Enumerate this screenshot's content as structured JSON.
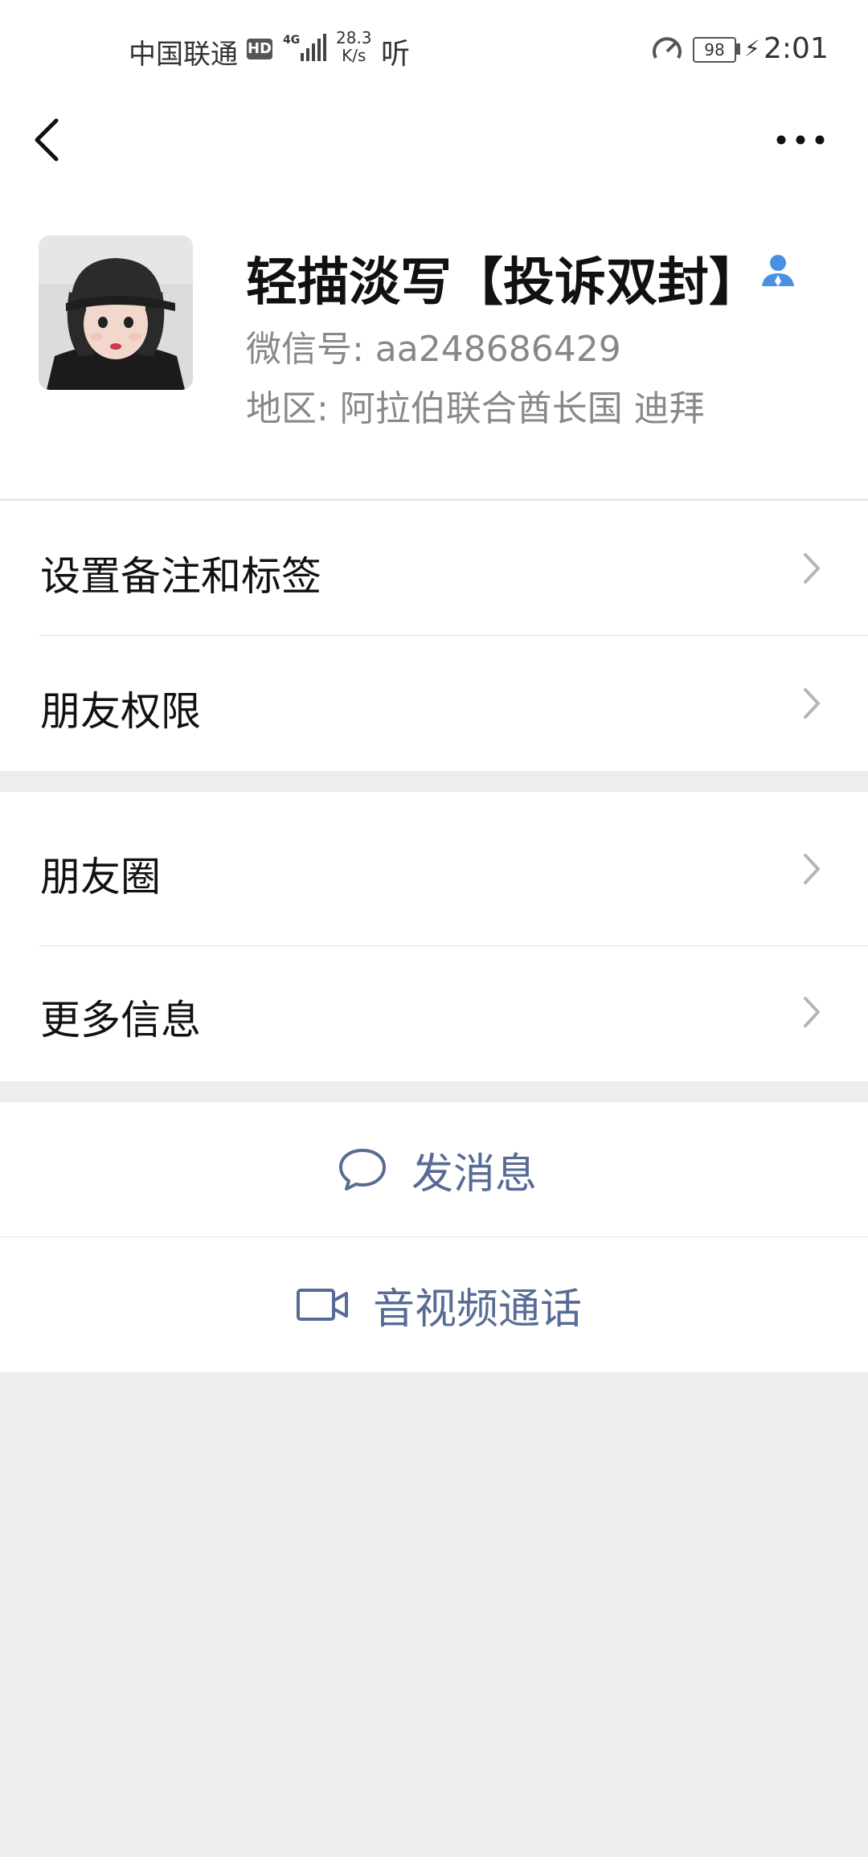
{
  "status_bar": {
    "carrier": "中国联通",
    "hd": "HD",
    "network": "4G",
    "speed_value": "28.3",
    "speed_unit": "K/s",
    "listen_icon_text": "听",
    "battery": "98",
    "time": "2:01"
  },
  "nav": {
    "back_icon": "chevron-left",
    "more_icon": "ellipsis"
  },
  "profile": {
    "nickname": "轻描淡写【投诉双封】",
    "wechat_id": "微信号: aa248686429",
    "region": "地区: 阿拉伯联合酋长国  迪拜",
    "friend_icon": "person-icon",
    "friend_icon_color": "#4a90e2"
  },
  "menu": {
    "remark_tags": "设置备注和标签",
    "permissions": "朋友权限",
    "moments": "朋友圈",
    "more_info": "更多信息"
  },
  "actions": {
    "send_message": "发消息",
    "video_call": "音视频通话",
    "action_color": "#576b95"
  }
}
